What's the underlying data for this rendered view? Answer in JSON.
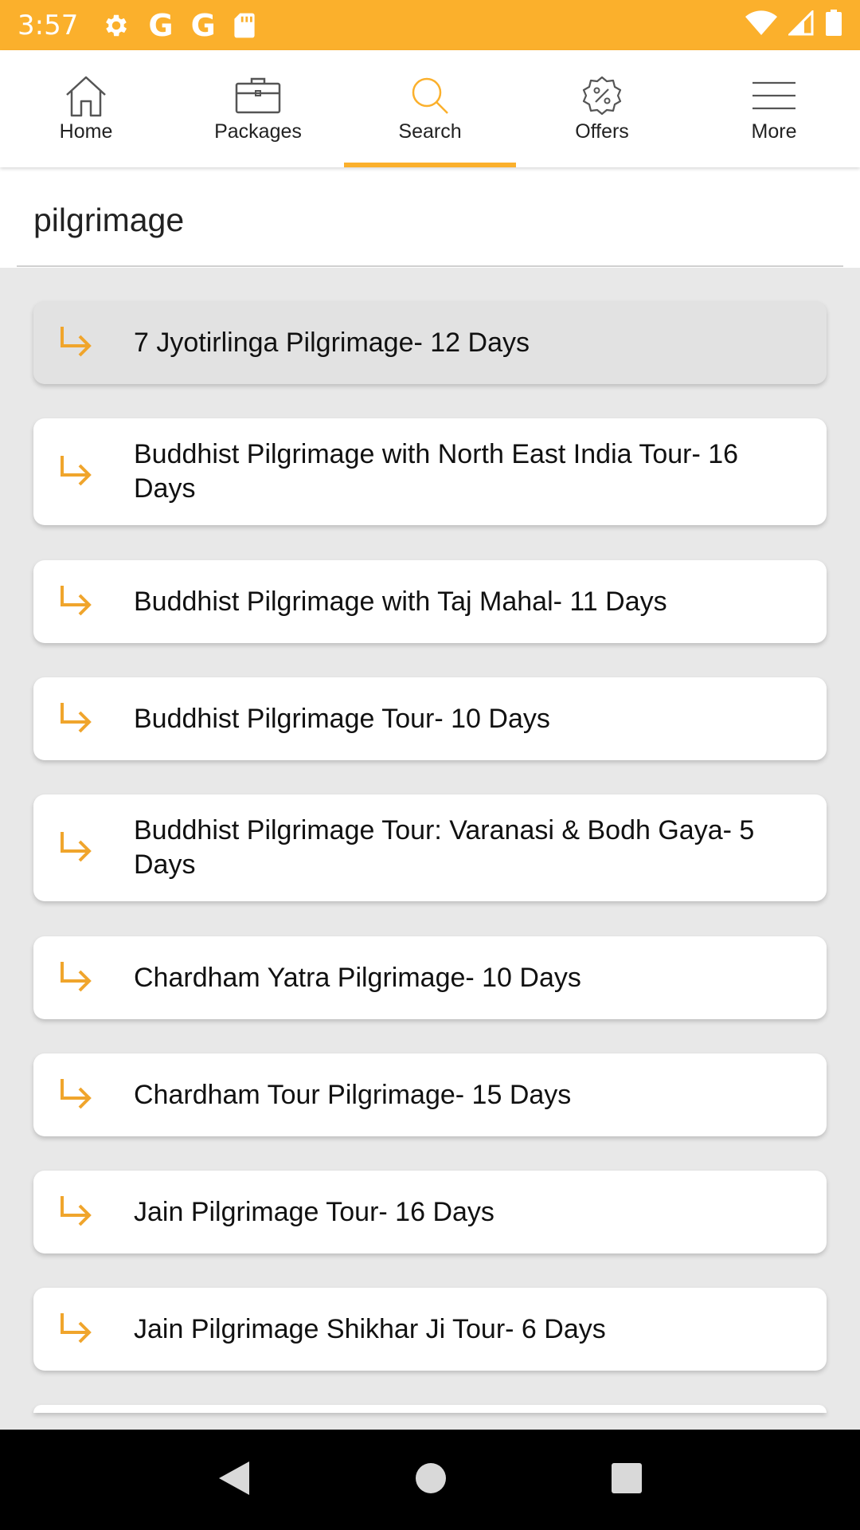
{
  "status_bar": {
    "time": "3:57",
    "icons": [
      "settings-icon",
      "google-icon",
      "google-icon",
      "sd-card-icon",
      "wifi-icon",
      "signal-icon",
      "battery-icon"
    ],
    "g1": "G",
    "g2": "G"
  },
  "colors": {
    "accent": "#fbb02c",
    "status_bar": "#fbb02c",
    "background": "#e8e8e8"
  },
  "nav": {
    "items": [
      {
        "label": "Home",
        "icon": "home-icon"
      },
      {
        "label": "Packages",
        "icon": "briefcase-icon"
      },
      {
        "label": "Search",
        "icon": "search-icon",
        "active": true
      },
      {
        "label": "Offers",
        "icon": "discount-badge-icon"
      },
      {
        "label": "More",
        "icon": "menu-icon"
      }
    ]
  },
  "search": {
    "value": "pilgrimage",
    "clear_icon": "close-icon"
  },
  "results": [
    "7 Jyotirlinga Pilgrimage- 12 Days",
    "Buddhist Pilgrimage with North East India Tour- 16 Days",
    "Buddhist Pilgrimage with Taj Mahal- 11 Days",
    "Buddhist Pilgrimage Tour- 10 Days",
    "Buddhist Pilgrimage Tour: Varanasi & Bodh Gaya- 5 Days",
    "Chardham Yatra Pilgrimage- 10 Days",
    "Chardham Tour Pilgrimage- 15 Days",
    "Jain Pilgrimage Tour- 16 Days",
    "Jain Pilgrimage Shikhar Ji Tour- 6 Days"
  ],
  "system_nav": {
    "icons": [
      "back-icon",
      "home-circle-icon",
      "recents-icon"
    ]
  }
}
